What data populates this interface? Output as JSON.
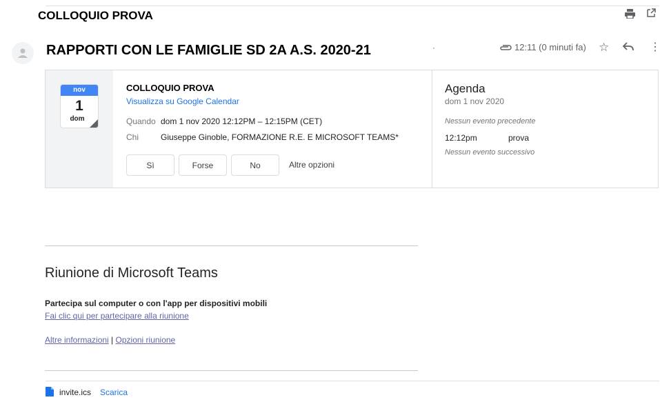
{
  "header": {
    "subject": "COLLOQUIO PROVA"
  },
  "message": {
    "sender": "RAPPORTI CON LE FAMIGLIE SD 2A A.S. 2020-21",
    "separator": "·",
    "time": "12:11 (0 minuti fa)"
  },
  "invite": {
    "calendar_icon": {
      "month": "nov",
      "day": "1",
      "weekday": "dom",
      "color": "#4285f4"
    },
    "title": "COLLOQUIO PROVA",
    "view_link": "Visualizza su Google Calendar",
    "when_label": "Quando",
    "when_value": "dom 1 nov 2020 12:12PM – 12:15PM (CET)",
    "who_label": "Chi",
    "who_value": "Giuseppe Ginoble, FORMAZIONE R.E. E MICROSOFT TEAMS*",
    "rsvp": {
      "yes": "Sì",
      "maybe": "Forse",
      "no": "No",
      "more": "Altre opzioni"
    }
  },
  "agenda": {
    "title": "Agenda",
    "date": "dom 1 nov 2020",
    "prev": "Nessun evento precedente",
    "event_time": "12:12pm",
    "event_name": "prova",
    "next": "Nessun evento successivo"
  },
  "body": {
    "teams_title": "Riunione di Microsoft Teams",
    "join_heading": "Partecipa sul computer o con l'app per dispositivi mobili",
    "join_link": "Fai clic qui per partecipare alla riunione",
    "more_info": "Altre informazioni",
    "divider": "|",
    "meeting_options": "Opzioni riunione"
  },
  "attachment": {
    "file_name": "invite.ics",
    "download": "Scarica"
  }
}
